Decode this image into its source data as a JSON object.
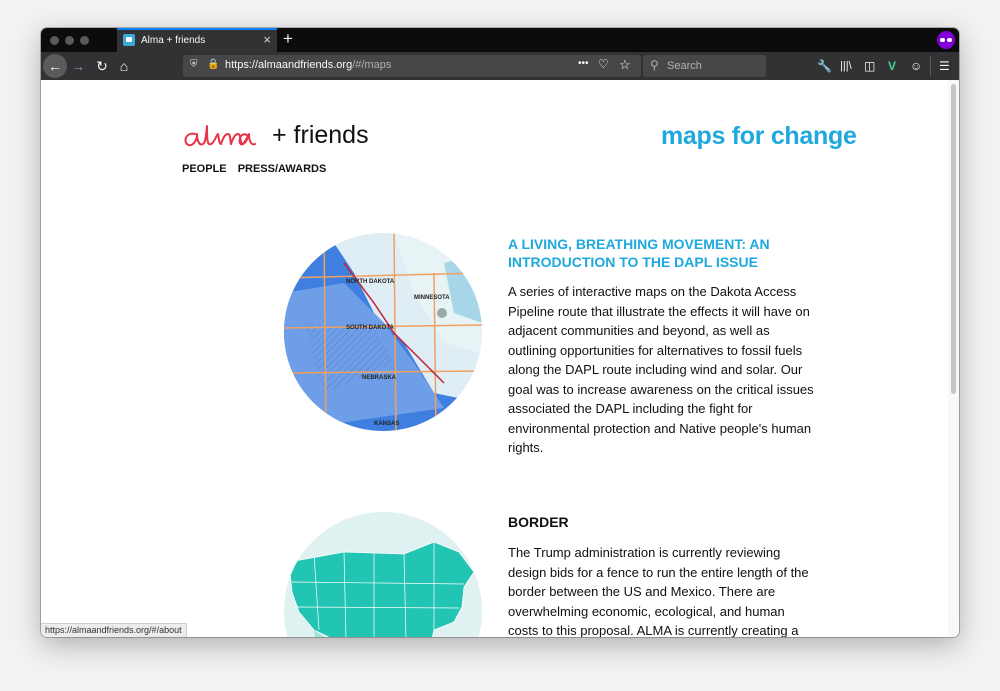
{
  "browser": {
    "tab_title": "Alma + friends",
    "tab_close": "×",
    "new_tab": "+",
    "url_host": "https://almaandfriends.org",
    "url_path": "/#/maps",
    "search_placeholder": "Search",
    "page_actions": "•••",
    "status_url": "https://almaandfriends.org/#/about"
  },
  "site": {
    "logo_text": "alma",
    "logo_suffix": "+ friends",
    "nav": [
      "PEOPLE",
      "PRESS/AWARDS"
    ],
    "tagline": "maps for change",
    "brand_color": "#1fa8dd",
    "logo_color": "#e8334a"
  },
  "projects": [
    {
      "title": "A LIVING, BREATHING MOVEMENT: AN INTRODUCTION TO THE DAPL ISSUE",
      "description": "A series of interactive maps on the Dakota Access Pipeline route that illustrate the effects it will have on adjacent communities and beyond, as well as outlining opportunities for alternatives to fossil fuels along the DAPL route including wind and solar. Our goal was to increase awareness on the critical issues associated the DAPL including the fight for environmental protection and Native people's human rights.",
      "map_labels": [
        "NORTH DAKOTA",
        "MINNESOTA",
        "SOUTH DAKOTA",
        "NEBRASKA",
        "KANSAS"
      ]
    },
    {
      "title": "BORDER",
      "description": "The Trump administration is currently reviewing design bids for a fence to run the entire length of the border between the US and Mexico. There are overwhelming economic, ecological, and human costs to this proposal. ALMA is currently creating a"
    }
  ]
}
